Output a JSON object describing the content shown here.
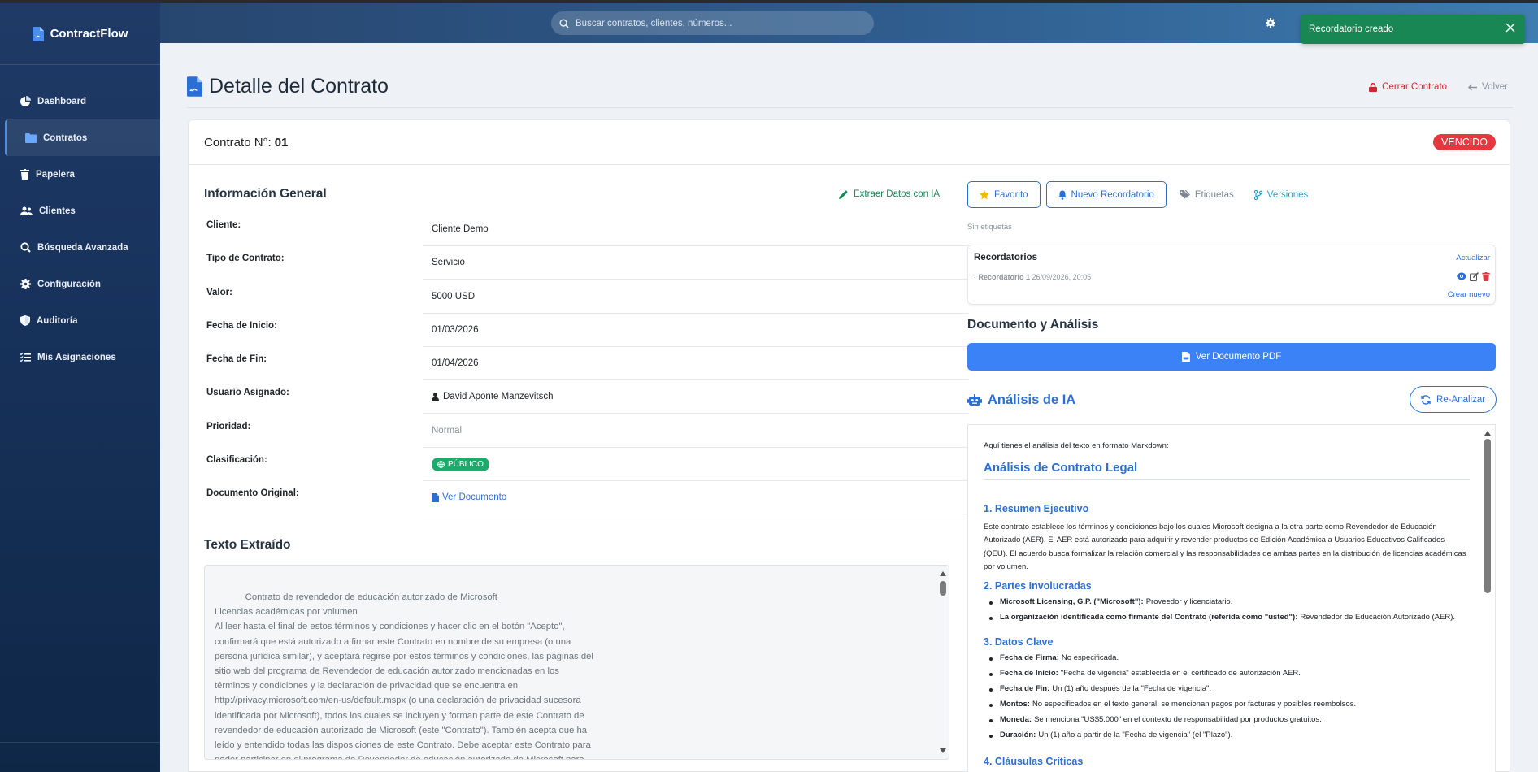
{
  "app": {
    "name": "ContractFlow"
  },
  "search": {
    "placeholder": "Buscar contratos, clientes, números..."
  },
  "toast": {
    "message": "Recordatorio creado"
  },
  "sidebar": {
    "items": [
      {
        "label": "Dashboard",
        "icon": "pie-chart-icon"
      },
      {
        "label": "Contratos",
        "icon": "folder-icon",
        "active": true
      },
      {
        "label": "Papelera",
        "icon": "trash-icon"
      },
      {
        "label": "Clientes",
        "icon": "users-icon"
      },
      {
        "label": "Búsqueda Avanzada",
        "icon": "search-icon"
      },
      {
        "label": "Configuración",
        "icon": "gear-icon"
      },
      {
        "label": "Auditoría",
        "icon": "shield-icon"
      },
      {
        "label": "Mis Asignaciones",
        "icon": "list-check-icon"
      }
    ]
  },
  "page": {
    "title": "Detalle del Contrato",
    "close_contract": "Cerrar Contrato",
    "back": "Volver"
  },
  "contract": {
    "number_label": "Contrato N°:",
    "number": "01",
    "status": "VENCIDO"
  },
  "general": {
    "title": "Información General",
    "extract_ai": "Extraer Datos con IA",
    "rows": [
      {
        "label": "Cliente:",
        "value": "Cliente Demo"
      },
      {
        "label": "Tipo de Contrato:",
        "value": "Servicio"
      },
      {
        "label": "Valor:",
        "value": "5000 USD"
      },
      {
        "label": "Fecha de Inicio:",
        "value": "01/03/2026"
      },
      {
        "label": "Fecha de Fin:",
        "value": "01/04/2026"
      },
      {
        "label": "Usuario Asignado:",
        "value": "David Aponte Manzevitsch"
      },
      {
        "label": "Prioridad:",
        "value": "Normal"
      },
      {
        "label": "Clasificación:",
        "value": "PÚBLICO"
      },
      {
        "label": "Documento Original:",
        "value": "Ver Documento"
      }
    ]
  },
  "extracted": {
    "title": "Texto Extraído",
    "text": "            Contrato de revendedor de educación autorizado de Microsoft\nLicencias académicas por volumen\nAl leer hasta el final de estos términos y condiciones y hacer clic en el botón \"Acepto\", confirmará que está autorizado a firmar este Contrato en nombre de su empresa (o una persona jurídica similar), y aceptará regirse por estos términos y condiciones, las páginas del sitio web del programa de Revendedor de educación autorizado mencionadas en los términos y condiciones y la declaración de privacidad que se encuentra en http://privacy.microsoft.com/en-us/default.mspx (o una declaración de privacidad sucesora identificada por Microsoft), todos los cuales se incluyen y forman parte de este Contrato de revendedor de educación autorizado de Microsoft (este \"Contrato\"). También acepta que ha leído y entendido todas las disposiciones de este Contrato. Debe aceptar este Contrato para poder participar en el programa de Revendedor de educación autorizado de Microsoft para licencias académicas por volumen."
  },
  "tools": {
    "favorite": "Favorito",
    "new_reminder": "Nuevo Recordatorio",
    "tags": "Etiquetas",
    "versions": "Versiones",
    "no_tags": "Sin etiquetas"
  },
  "reminders": {
    "title": "Recordatorios",
    "refresh": "Actualizar",
    "item_name": "Recordatorio 1",
    "item_date": "26/09/2026, 20:05",
    "create_new": "Crear nuevo"
  },
  "document": {
    "title": "Documento y Análisis",
    "view_pdf": "Ver Documento PDF"
  },
  "analysis": {
    "title": "Análisis de IA",
    "reanalyze": "Re-Analizar",
    "intro": "Aquí tienes el análisis del texto en formato Markdown:",
    "h1": "Análisis de Contrato Legal",
    "s1_title": "1. Resumen Ejecutivo",
    "s1_text": "Este contrato establece los términos y condiciones bajo los cuales Microsoft designa a la otra parte como Revendedor de Educación Autorizado (AER). El AER está autorizado para adquirir y revender productos de Edición Académica a Usuarios Educativos Calificados (QEU). El acuerdo busca formalizar la relación comercial y las responsabilidades de ambas partes en la distribución de licencias académicas por volumen.",
    "s2_title": "2. Partes Involucradas",
    "s2_items": [
      {
        "b": "Microsoft Licensing, G.P. (\"Microsoft\"):",
        "t": "Proveedor y licenciatario."
      },
      {
        "b": "La organización identificada como firmante del Contrato (referida como \"usted\"):",
        "t": "Revendedor de Educación Autorizado (AER)."
      }
    ],
    "s3_title": "3. Datos Clave",
    "s3_items": [
      {
        "b": "Fecha de Firma:",
        "t": "No especificada."
      },
      {
        "b": "Fecha de Inicio:",
        "t": "\"Fecha de vigencia\" establecida en el certificado de autorización AER."
      },
      {
        "b": "Fecha de Fin:",
        "t": "Un (1) año después de la \"Fecha de vigencia\"."
      },
      {
        "b": "Montos:",
        "t": "No especificados en el texto general, se mencionan pagos por facturas y posibles reembolsos."
      },
      {
        "b": "Moneda:",
        "t": "Se menciona \"US$5.000\" en el contexto de responsabilidad por productos gratuitos."
      },
      {
        "b": "Duración:",
        "t": "Un (1) año a partir de la \"Fecha de vigencia\" (el \"Plazo\")."
      }
    ],
    "s4_title": "4. Cláusulas Críticas"
  },
  "colors": {
    "primary": "#3b82f6",
    "danger": "#e5373f",
    "success": "#198754",
    "sidebar": "#17325b"
  }
}
